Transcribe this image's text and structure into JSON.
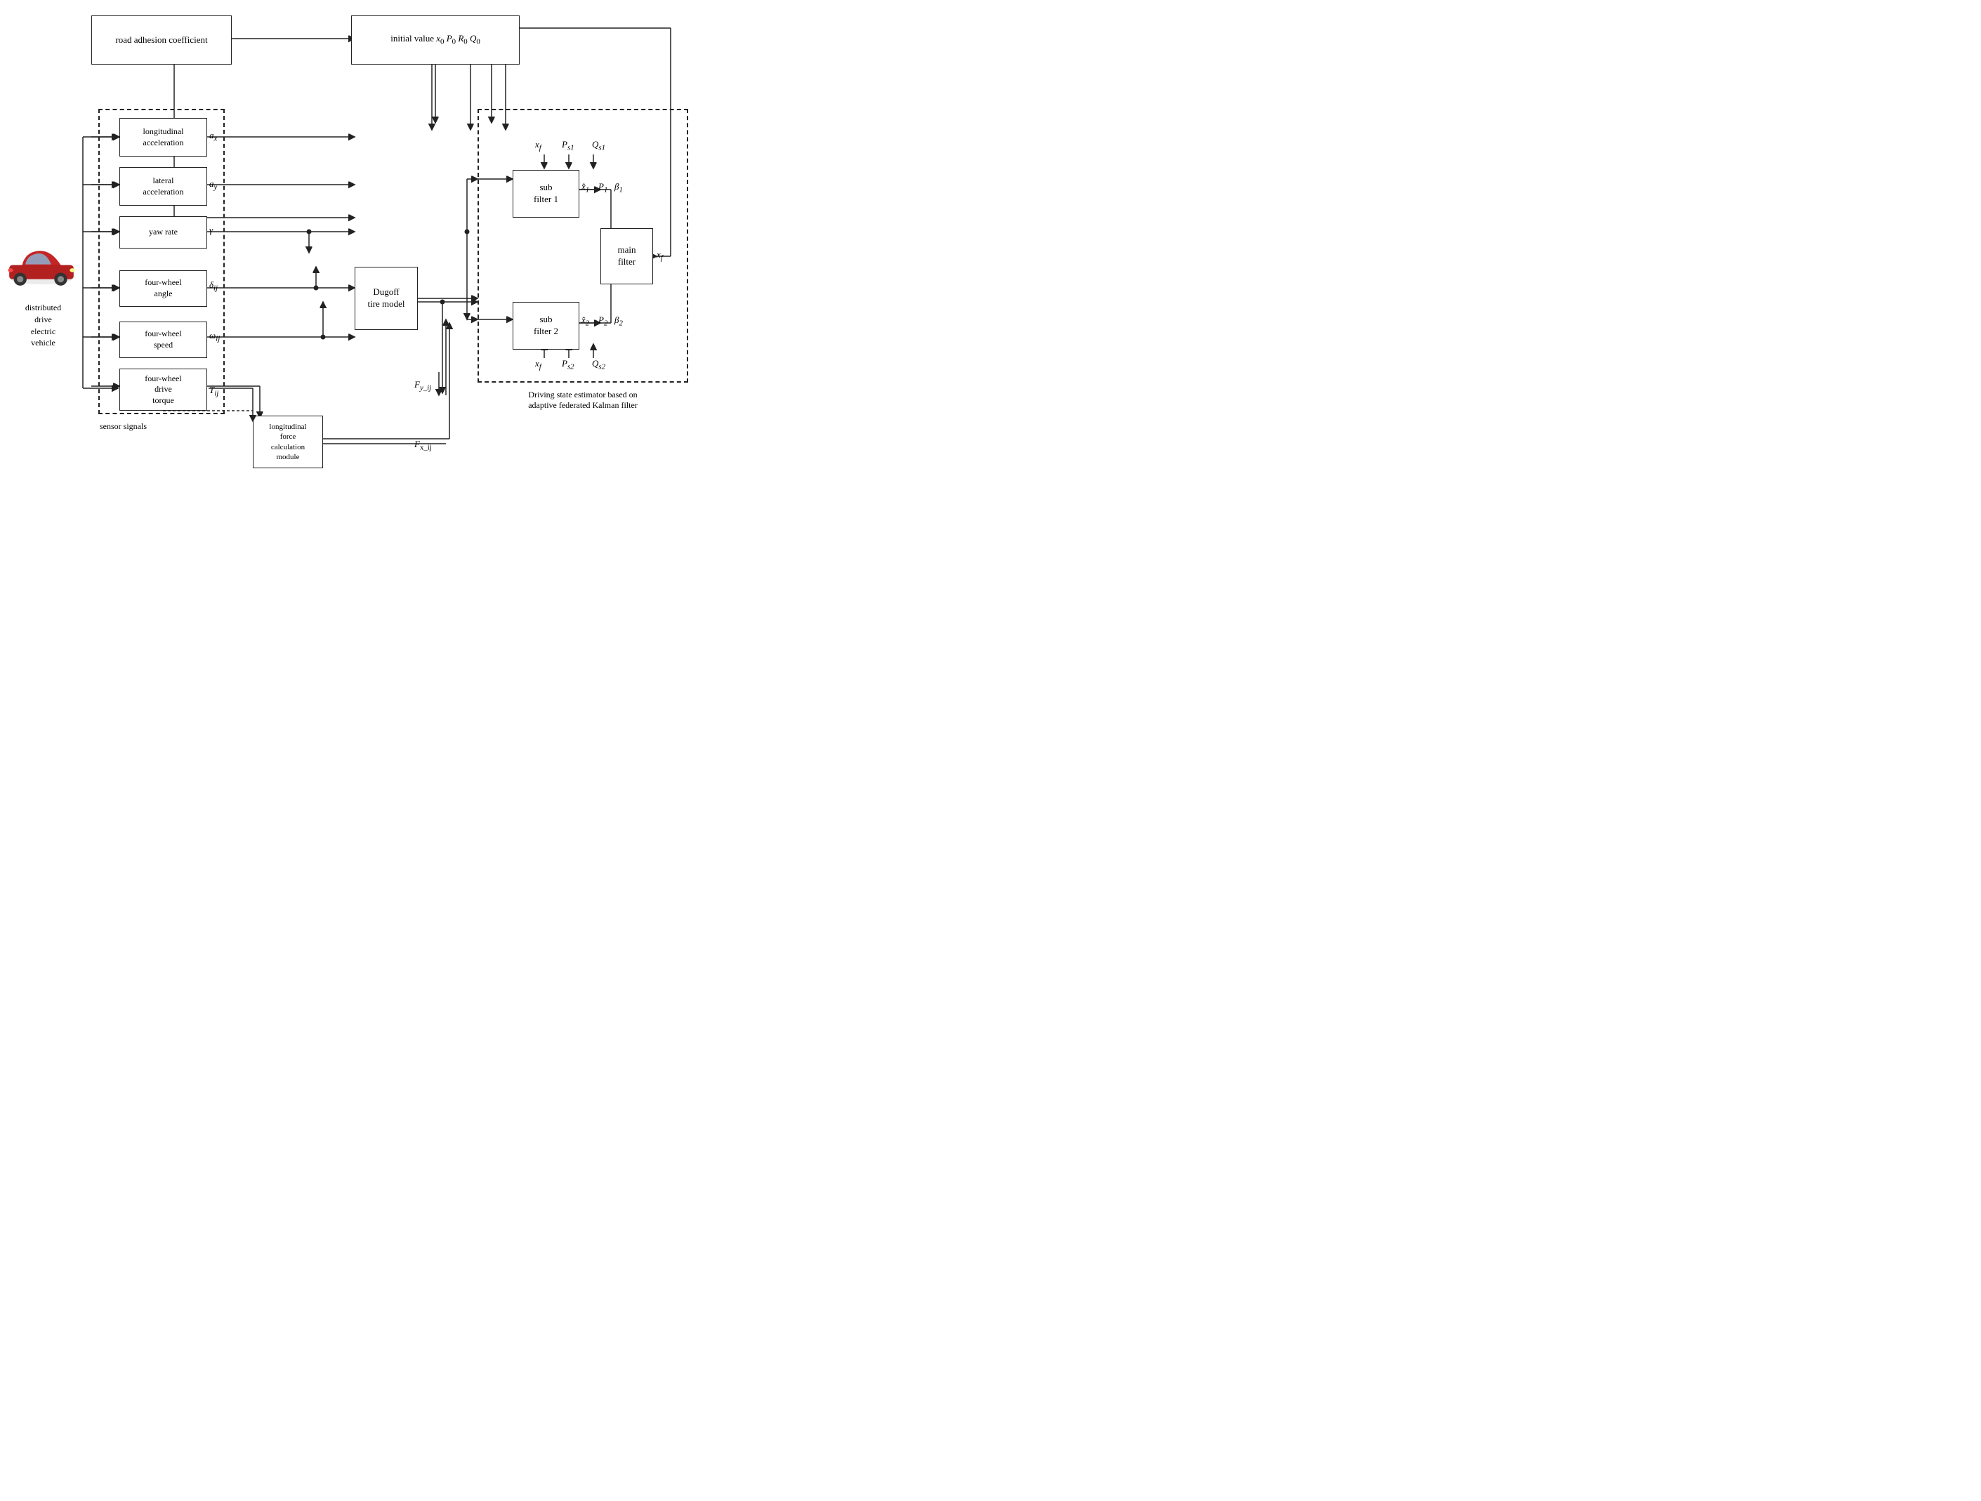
{
  "blocks": {
    "road_adhesion": {
      "label": "road adhesion\ncoefficient"
    },
    "initial_value": {
      "label": "initial value x₀ P₀ R₀ Q₀"
    },
    "longitudinal_accel": {
      "label": "longitudinal\nacceleration"
    },
    "lateral_accel": {
      "label": "lateral\nacceleration"
    },
    "yaw_rate": {
      "label": "yaw rate"
    },
    "four_wheel_angle": {
      "label": "four-wheel\nangle"
    },
    "four_wheel_speed": {
      "label": "four-wheel\nspeed"
    },
    "four_wheel_torque": {
      "label": "four-wheel\ndrive\ntorque"
    },
    "dugoff": {
      "label": "Dugoff\ntire model"
    },
    "long_force": {
      "label": "longitudinal\nforce\ncalculation\nmodule"
    },
    "sub_filter_1": {
      "label": "sub\nfilter 1"
    },
    "sub_filter_2": {
      "label": "sub\nfilter 2"
    },
    "main_filter": {
      "label": "main\nfilter"
    }
  },
  "labels": {
    "ax": "a_x",
    "ay": "a_y",
    "gamma": "γ",
    "delta_ij": "δ_ij",
    "omega_ij": "ω_ij",
    "T_ij": "T_ij",
    "F_y_ij": "F_y_ij",
    "F_x_ij": "F_x_ij",
    "xf_top": "x_f",
    "Ps1": "P_s1",
    "Qs1": "Q_s1",
    "xhat1": "x̂₁",
    "P1": "P₁",
    "beta1": "β₁",
    "xhat2": "x̂₂",
    "P2": "P₂",
    "beta2": "β₂",
    "xf_bottom": "x_f",
    "Ps2": "P_s2",
    "Qs2": "Q_s2",
    "xf_output": "x_f",
    "sensor_signals": "sensor signals",
    "distributed_drive": "distributed\ndrive\nelectric\nvehicle",
    "driving_state": "Driving state estimator based on\nadaptive federated Kalman filter"
  }
}
